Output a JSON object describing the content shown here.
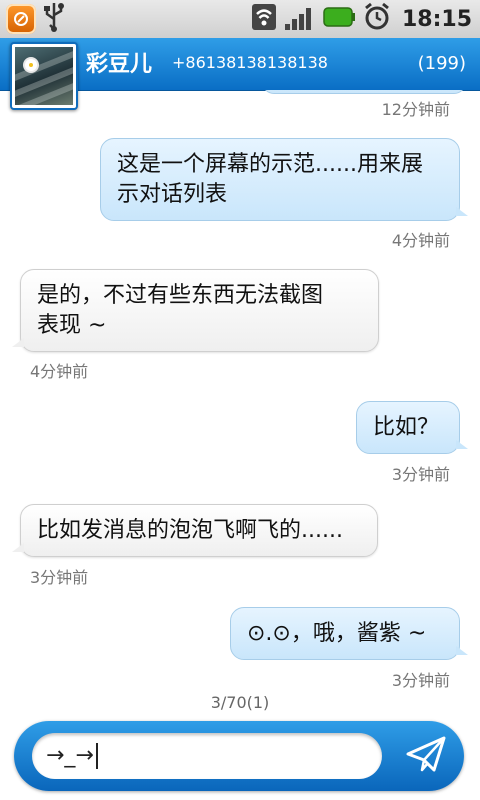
{
  "status_bar": {
    "time": "18:15",
    "icons": [
      "app-notification-icon",
      "usb-icon",
      "wifi-icon",
      "signal-icon",
      "battery-icon",
      "alarm-icon"
    ]
  },
  "header": {
    "contact_name": "彩豆儿",
    "phone_number": "+86138138138138",
    "message_count": "(199)"
  },
  "messages": [
    {
      "direction": "outgoing",
      "text": "",
      "time": "12分钟前"
    },
    {
      "direction": "outgoing",
      "line1": "这是一个屏幕的示范......用来展",
      "line2": "示对话列表",
      "time": "4分钟前"
    },
    {
      "direction": "incoming",
      "line1": "是的，不过有些东西无法截图",
      "line2": "表现 ~",
      "time": "4分钟前"
    },
    {
      "direction": "outgoing",
      "text": "比如？",
      "time": "3分钟前"
    },
    {
      "direction": "incoming",
      "text": "比如发消息的泡泡飞啊飞的......",
      "time": "3分钟前"
    },
    {
      "direction": "outgoing",
      "text": "⊙.⊙，哦，酱紫 ~",
      "time": "3分钟前"
    }
  ],
  "page_indicator": "3/70(1)",
  "composer": {
    "value": "→_→",
    "send_icon": "send-paper-plane-icon"
  },
  "colors": {
    "accent_blue": "#1a7fd6",
    "outgoing_bubble": "#d6ecfc",
    "incoming_bubble": "#f7f7f7",
    "timestamp": "#777777"
  }
}
